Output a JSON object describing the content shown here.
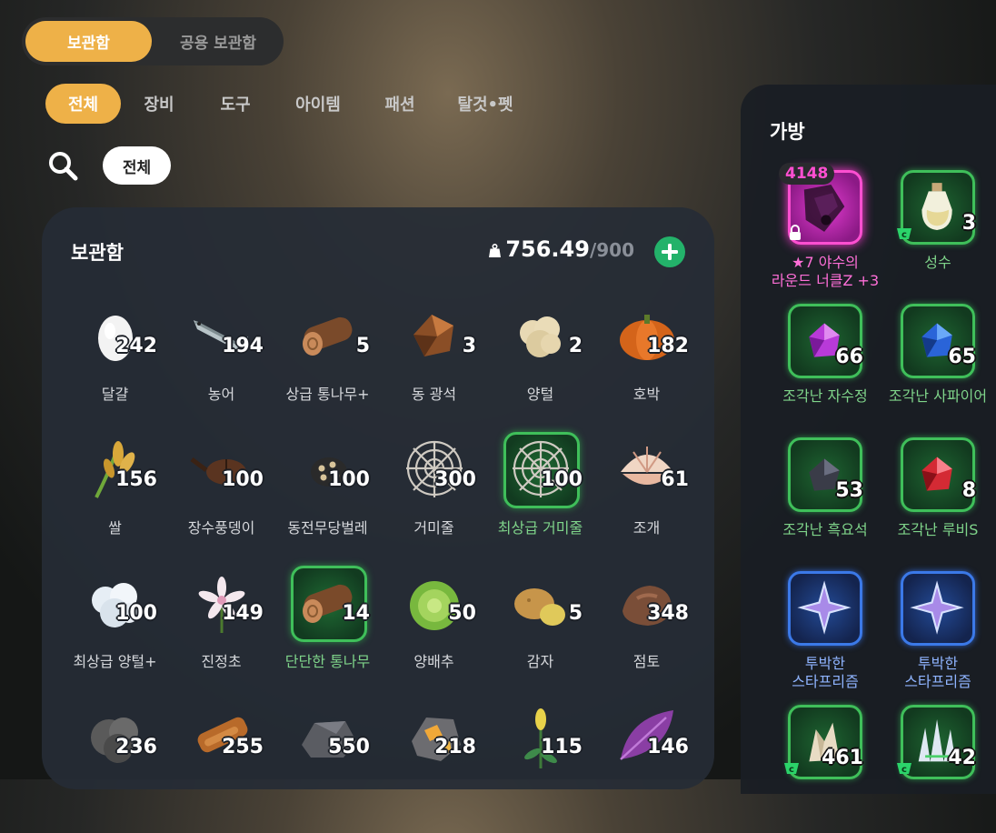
{
  "top_toggle": {
    "active": "보관함",
    "inactive": "공용 보관함"
  },
  "tabs": [
    "전체",
    "장비",
    "도구",
    "아이템",
    "패션",
    "탈것•펫"
  ],
  "filter": {
    "chip": "전체"
  },
  "storage": {
    "title": "보관함",
    "weight_current": "756.49",
    "weight_max": "/900",
    "items": [
      {
        "name": "달걀",
        "qty": "242",
        "icon": "egg-icon"
      },
      {
        "name": "농어",
        "qty": "194",
        "icon": "fish-icon"
      },
      {
        "name": "상급 통나무+",
        "qty": "5",
        "icon": "log-icon"
      },
      {
        "name": "동 광석",
        "qty": "3",
        "icon": "copper-ore-icon"
      },
      {
        "name": "양털",
        "qty": "2",
        "icon": "wool-icon"
      },
      {
        "name": "호박",
        "qty": "182",
        "icon": "pumpkin-icon"
      },
      {
        "name": "쌀",
        "qty": "156",
        "icon": "rice-icon"
      },
      {
        "name": "장수풍뎅이",
        "qty": "100",
        "icon": "beetle-icon"
      },
      {
        "name": "동전무당벌레",
        "qty": "100",
        "icon": "ladybug-icon"
      },
      {
        "name": "거미줄",
        "qty": "300",
        "icon": "spiderweb-icon"
      },
      {
        "name": "최상급 거미줄",
        "qty": "100",
        "icon": "spiderweb-icon",
        "rare": true
      },
      {
        "name": "조개",
        "qty": "61",
        "icon": "clam-icon"
      },
      {
        "name": "최상급 양털+",
        "qty": "100",
        "icon": "wool-white-icon"
      },
      {
        "name": "진정초",
        "qty": "149",
        "icon": "flower-icon"
      },
      {
        "name": "단단한 통나무",
        "qty": "14",
        "icon": "log-icon",
        "rare": true
      },
      {
        "name": "양배추",
        "qty": "50",
        "icon": "cabbage-icon"
      },
      {
        "name": "감자",
        "qty": "5",
        "icon": "potato-icon"
      },
      {
        "name": "점토",
        "qty": "348",
        "icon": "clay-icon"
      },
      {
        "name": "",
        "qty": "236",
        "icon": "coal-icon"
      },
      {
        "name": "",
        "qty": "255",
        "icon": "wood-plank-icon"
      },
      {
        "name": "",
        "qty": "550",
        "icon": "stone-icon"
      },
      {
        "name": "",
        "qty": "218",
        "icon": "gold-ore-icon"
      },
      {
        "name": "",
        "qty": "115",
        "icon": "wheat-sprout-icon"
      },
      {
        "name": "",
        "qty": "146",
        "icon": "purple-leaf-icon"
      }
    ]
  },
  "bag": {
    "title": "가방",
    "items": [
      {
        "name_line1": "★7 야수의",
        "name_line2": "라운드 너클Z +3",
        "badge": "4148",
        "qty": "",
        "frame": "pink",
        "icon": "knuckle-icon",
        "locked": true
      },
      {
        "name_line1": "성수",
        "name_line2": "",
        "qty": "3",
        "frame": "green",
        "icon": "holy-water-icon",
        "tradeable": true
      },
      {
        "name_line1": "조각난 자수정",
        "name_line2": "",
        "qty": "66",
        "frame": "green",
        "icon": "amethyst-icon"
      },
      {
        "name_line1": "조각난 사파이어",
        "name_line2": "",
        "qty": "65",
        "frame": "green",
        "icon": "sapphire-icon"
      },
      {
        "name_line1": "조각난 흑요석",
        "name_line2": "",
        "qty": "53",
        "frame": "green",
        "icon": "obsidian-icon"
      },
      {
        "name_line1": "조각난 루비S",
        "name_line2": "",
        "qty": "8",
        "frame": "green",
        "icon": "ruby-icon"
      },
      {
        "name_line1": "투박한",
        "name_line2": "스타프리즘",
        "qty": "",
        "frame": "blue",
        "icon": "star-prism-icon"
      },
      {
        "name_line1": "투박한",
        "name_line2": "스타프리즘",
        "qty": "",
        "frame": "blue",
        "icon": "star-prism-icon"
      },
      {
        "name_line1": "",
        "name_line2": "",
        "qty": "461",
        "frame": "green",
        "icon": "crystal-cluster-icon",
        "tradeable": true
      },
      {
        "name_line1": "",
        "name_line2": "",
        "qty": "42",
        "frame": "green",
        "icon": "crystal-shards-icon",
        "tradeable": true
      }
    ]
  },
  "colors": {
    "accent": "#eeb148",
    "rare_green": "#3fbf5a",
    "add_green": "#23b26a",
    "epic_pink": "#ff4fd1",
    "blue": "#3b79e8"
  }
}
